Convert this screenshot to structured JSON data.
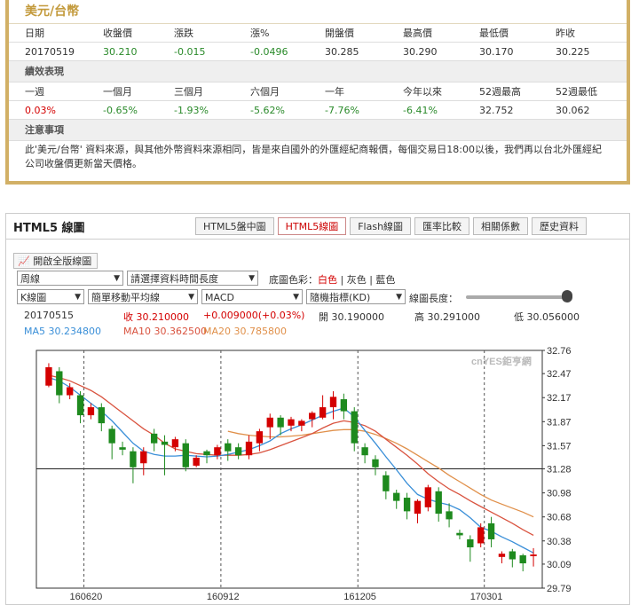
{
  "quote": {
    "title": "美元/台幣",
    "headers": [
      "日期",
      "收盤價",
      "漲跌",
      "漲%",
      "開盤價",
      "最高價",
      "最低價",
      "昨收"
    ],
    "values": [
      "20170519",
      "30.210",
      "-0.015",
      "-0.0496",
      "30.285",
      "30.290",
      "30.170",
      "30.225"
    ],
    "perf_title": "績效表現",
    "perf_headers": [
      "一週",
      "一個月",
      "三個月",
      "六個月",
      "一年",
      "今年以來",
      "52週最高",
      "52週最低"
    ],
    "perf_values": [
      "0.03%",
      "-0.65%",
      "-1.93%",
      "-5.62%",
      "-7.76%",
      "-6.41%",
      "32.752",
      "30.062"
    ],
    "note_title": "注意事項",
    "note_text": "此'美元/台幣' 資料來源，與其他外幣資料來源相同，皆是來自國外的外匯經紀商報價，每個交易日18:00以後，我們再以台北外匯經紀公司收盤價更新當天價格。"
  },
  "panel": {
    "title": "HTML5 線圖",
    "tabs": [
      "HTML5盤中圖",
      "HTML5線圖",
      "Flash線圖",
      "匯率比較",
      "相關係數",
      "歷史資料"
    ],
    "full_btn": "開啟全版線圖",
    "period": "周線",
    "range_placeholder": "請選擇資料時間長度",
    "bg_label": "底圖色彩：",
    "bg_white": "白色",
    "bg_gray": "灰色",
    "bg_blue": "藍色",
    "sel_chart": "K線圖",
    "sel_ma": "簡單移動平均線",
    "sel_macd": "MACD",
    "sel_kd": "隨機指標(KD)",
    "zoom_label": "線圖長度：",
    "zoom_level": 0.95,
    "info_date": "20170515",
    "info_close": "收 30.210000",
    "info_change": "+0.009000(+0.03%)",
    "info_open": "開 30.190000",
    "info_high": "高 30.291000",
    "info_low": "低 30.056000",
    "ma5": "MA5 30.234800",
    "ma10": "MA10 30.362500",
    "ma20": "MA20 30.785800",
    "watermark": "cnYES鉅亨網"
  },
  "colors": {
    "up": "#d40000",
    "down": "#1e8a1e",
    "ma5": "#3a8fd8",
    "ma10": "#d9533f",
    "ma20": "#e0904a",
    "gold": "#d2b066"
  },
  "chart_data": {
    "type": "candlestick",
    "yticks": [
      "32.76",
      "32.47",
      "32.17",
      "31.87",
      "31.57",
      "31.28",
      "30.98",
      "30.68",
      "30.38",
      "30.09",
      "29.79"
    ],
    "xticks": [
      "160620",
      "160912",
      "161205",
      "170301"
    ],
    "ylim": [
      29.79,
      32.76
    ],
    "candles": [
      [
        32.32,
        32.55,
        32.3,
        32.6
      ],
      [
        32.5,
        32.2,
        32.1,
        32.55
      ],
      [
        32.2,
        32.3,
        32.15,
        32.35
      ],
      [
        32.2,
        31.95,
        31.85,
        32.25
      ],
      [
        31.95,
        32.05,
        31.9,
        32.1
      ],
      [
        32.05,
        31.85,
        31.75,
        32.1
      ],
      [
        31.78,
        31.6,
        31.4,
        31.82
      ],
      [
        31.55,
        31.52,
        31.45,
        31.62
      ],
      [
        31.5,
        31.3,
        31.1,
        31.55
      ],
      [
        31.35,
        31.5,
        31.2,
        31.55
      ],
      [
        31.72,
        31.6,
        31.5,
        31.78
      ],
      [
        31.62,
        31.58,
        31.2,
        31.7
      ],
      [
        31.55,
        31.65,
        31.5,
        31.68
      ],
      [
        31.6,
        31.3,
        31.25,
        31.65
      ],
      [
        31.32,
        31.42,
        31.3,
        31.45
      ],
      [
        31.5,
        31.45,
        31.35,
        31.52
      ],
      [
        31.45,
        31.55,
        31.4,
        31.58
      ],
      [
        31.6,
        31.5,
        31.38,
        31.65
      ],
      [
        31.55,
        31.45,
        31.4,
        31.6
      ],
      [
        31.45,
        31.62,
        31.4,
        31.7
      ],
      [
        31.6,
        31.75,
        31.5,
        31.78
      ],
      [
        31.8,
        31.92,
        31.65,
        31.97
      ],
      [
        31.92,
        31.8,
        31.7,
        31.95
      ],
      [
        31.82,
        31.9,
        31.75,
        31.93
      ],
      [
        31.82,
        31.88,
        31.75,
        31.9
      ],
      [
        31.9,
        31.98,
        31.8,
        32.0
      ],
      [
        31.92,
        32.05,
        31.9,
        32.2
      ],
      [
        32.05,
        32.18,
        31.9,
        32.25
      ],
      [
        32.15,
        32.0,
        31.9,
        32.22
      ],
      [
        32.0,
        31.6,
        31.5,
        32.05
      ],
      [
        31.55,
        31.45,
        31.35,
        31.6
      ],
      [
        31.4,
        31.3,
        31.2,
        31.45
      ],
      [
        31.2,
        31.0,
        30.9,
        31.25
      ],
      [
        30.98,
        30.88,
        30.78,
        31.02
      ],
      [
        30.92,
        30.75,
        30.65,
        30.98
      ],
      [
        30.72,
        30.88,
        30.6,
        30.9
      ],
      [
        30.8,
        31.05,
        30.75,
        31.08
      ],
      [
        31.0,
        30.72,
        30.62,
        31.05
      ],
      [
        30.75,
        30.65,
        30.55,
        30.85
      ],
      [
        30.48,
        30.45,
        30.4,
        30.52
      ],
      [
        30.4,
        30.3,
        30.12,
        30.45
      ],
      [
        30.35,
        30.55,
        30.3,
        30.6
      ],
      [
        30.6,
        30.4,
        30.3,
        30.68
      ],
      [
        30.18,
        30.22,
        30.1,
        30.25
      ],
      [
        30.25,
        30.15,
        30.05,
        30.28
      ],
      [
        30.2,
        30.1,
        30.0,
        30.22
      ],
      [
        30.19,
        30.21,
        30.06,
        30.29
      ]
    ],
    "ma5": [
      32.42,
      32.38,
      32.3,
      32.2,
      32.1,
      32.0,
      31.88,
      31.74,
      31.6,
      31.5,
      31.46,
      31.44,
      31.44,
      31.45,
      31.44,
      31.43,
      31.44,
      31.46,
      31.49,
      31.52,
      31.57,
      31.63,
      31.72,
      31.78,
      31.83,
      31.89,
      31.95,
      32.0,
      32.04,
      31.93,
      31.76,
      31.6,
      31.43,
      31.27,
      31.1,
      30.96,
      30.9,
      30.86,
      30.83,
      30.77,
      30.67,
      30.55,
      30.5,
      30.43,
      30.37,
      30.3,
      30.23
    ],
    "ma10": [
      32.45,
      32.42,
      32.38,
      32.32,
      32.26,
      32.18,
      32.08,
      31.98,
      31.88,
      31.78,
      31.7,
      31.6,
      31.53,
      31.5,
      31.47,
      31.46,
      31.45,
      31.45,
      31.45,
      31.46,
      31.48,
      31.52,
      31.57,
      31.62,
      31.67,
      31.72,
      31.79,
      31.85,
      31.88,
      31.86,
      31.82,
      31.75,
      31.65,
      31.55,
      31.45,
      31.34,
      31.22,
      31.12,
      31.03,
      30.96,
      30.88,
      30.81,
      30.74,
      30.67,
      30.6,
      30.52,
      30.45
    ],
    "ma20": [
      null,
      null,
      null,
      null,
      null,
      null,
      null,
      null,
      null,
      null,
      null,
      null,
      null,
      null,
      null,
      null,
      null,
      31.75,
      31.72,
      31.7,
      31.69,
      31.68,
      31.68,
      31.69,
      31.7,
      31.72,
      31.74,
      31.76,
      31.77,
      31.77,
      31.75,
      31.71,
      31.66,
      31.6,
      31.53,
      31.45,
      31.37,
      31.29,
      31.2,
      31.12,
      31.04,
      30.96,
      30.89,
      30.84,
      30.79,
      30.74,
      30.68
    ]
  }
}
